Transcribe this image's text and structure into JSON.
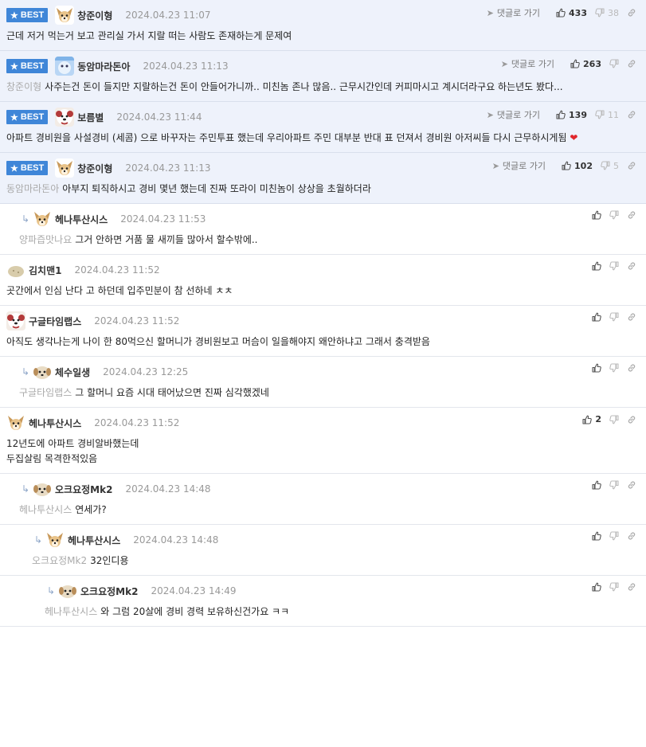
{
  "ui": {
    "reply_label": "댓글로 가기",
    "best_label": "BEST"
  },
  "comments": [
    {
      "best": true,
      "level": 0,
      "nick": "창준이형",
      "avatar": "dog",
      "date": "2024.04.23 11:07",
      "mention": "",
      "lines": [
        "근데 저거 먹는거 보고 관리실 가서 지랄 떠는 사람도 존재하는게 문제여"
      ],
      "likes": "433",
      "dislikes": "38"
    },
    {
      "best": true,
      "level": 0,
      "nick": "동암마라돈아",
      "avatar": "blue",
      "date": "2024.04.23 11:13",
      "mention": "창준이형",
      "lines": [
        "사주는건 돈이 들지만 지랄하는건 돈이 안들어가니까.. 미친놈 존나 많음.. 근무시간인데 커피마시고 계시더라구요 하는년도 봤다..."
      ],
      "likes": "263",
      "dislikes": ""
    },
    {
      "best": true,
      "level": 0,
      "nick": "보름별",
      "avatar": "fluffy",
      "date": "2024.04.23 11:44",
      "mention": "",
      "lines": [
        "아파트 경비원을 사설경비 (세콤) 으로 바꾸자는 주민투표 했는데 우리아파트 주민 대부분 반대 표 던져서 경비원 아저씨들 다시 근무하시게됨"
      ],
      "heart": "❤",
      "likes": "139",
      "dislikes": "11"
    },
    {
      "best": true,
      "level": 0,
      "nick": "창준이형",
      "avatar": "dog",
      "date": "2024.04.23 11:13",
      "mention": "동암마라돈아",
      "lines": [
        "아부지 퇴직하시고 경비 몇년 했는데 진짜 또라이 미친놈이 상상을 초월하더라"
      ],
      "likes": "102",
      "dislikes": "5"
    },
    {
      "best": false,
      "level": 1,
      "nick": "헤나투산시스",
      "avatar": "dog",
      "date": "2024.04.23 11:53",
      "mention": "양파즙맛나요",
      "lines": [
        "그거 안하면 거품 물 새끼들 많아서 할수밖에.."
      ],
      "likes": "",
      "dislikes": ""
    },
    {
      "best": false,
      "level": 0,
      "nick": "김치맨1",
      "avatar": "potato",
      "date": "2024.04.23 11:52",
      "mention": "",
      "lines": [
        "곳간에서 인심 난다 고 하던데 입주민분이 참 선하네 ㅊㅊ"
      ],
      "likes": "",
      "dislikes": ""
    },
    {
      "best": false,
      "level": 0,
      "nick": "구글타임랩스",
      "avatar": "fluffy",
      "date": "2024.04.23 11:52",
      "mention": "",
      "lines": [
        "아직도 생각나는게 나이 한 80먹으신 할머니가 경비원보고 머슴이 일을해야지 왜안하냐고 그래서 충격받음"
      ],
      "likes": "",
      "dislikes": ""
    },
    {
      "best": false,
      "level": 1,
      "nick": "체수일생",
      "avatar": "puppy",
      "date": "2024.04.23 12:25",
      "mention": "구글타임랩스",
      "lines": [
        "그 할머니 요즘 시대 태어났으면 진짜 심각했겠네"
      ],
      "likes": "",
      "dislikes": ""
    },
    {
      "best": false,
      "level": 0,
      "nick": "헤나투산시스",
      "avatar": "dog",
      "date": "2024.04.23 11:52",
      "mention": "",
      "lines": [
        "12년도에 아파트 경비알바했는데",
        "두집살림 목격한적있음"
      ],
      "likes": "2",
      "dislikes": ""
    },
    {
      "best": false,
      "level": 1,
      "nick": "오크요정Mk2",
      "avatar": "puppy",
      "date": "2024.04.23 14:48",
      "mention": "헤나투산시스",
      "lines": [
        "연세가?"
      ],
      "likes": "",
      "dislikes": ""
    },
    {
      "best": false,
      "level": 2,
      "nick": "헤나투산시스",
      "avatar": "dog",
      "date": "2024.04.23 14:48",
      "mention": "오크요정Mk2",
      "lines": [
        "32인디용"
      ],
      "likes": "",
      "dislikes": ""
    },
    {
      "best": false,
      "level": 3,
      "nick": "오크요정Mk2",
      "avatar": "puppy",
      "date": "2024.04.23 14:49",
      "mention": "헤나투산시스",
      "lines": [
        "와 그럼 20살에 경비 경력 보유하신건가요 ㅋㅋ"
      ],
      "likes": "",
      "dislikes": ""
    }
  ]
}
